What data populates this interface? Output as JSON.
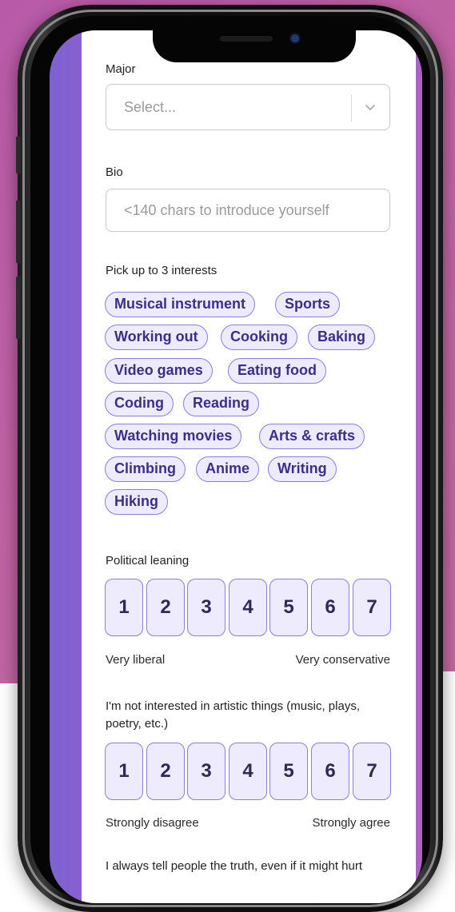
{
  "form": {
    "major": {
      "label": "Major",
      "placeholder": "Select..."
    },
    "bio": {
      "label": "Bio",
      "placeholder": "<140 chars to introduce yourself"
    },
    "interests": {
      "label": "Pick up to 3 interests",
      "chips": [
        "Musical instrument",
        "Sports",
        "Working out",
        "Cooking",
        "Baking",
        "Video games",
        "Eating food",
        "Coding",
        "Reading",
        "Watching movies",
        "Arts & crafts",
        "Climbing",
        "Anime",
        "Writing",
        "Hiking"
      ]
    },
    "political": {
      "label": "Political leaning",
      "options": [
        "1",
        "2",
        "3",
        "4",
        "5",
        "6",
        "7"
      ],
      "left_label": "Very liberal",
      "right_label": "Very conservative"
    },
    "artistic": {
      "label": "I'm not interested in artistic things (music, plays, poetry, etc.)",
      "options": [
        "1",
        "2",
        "3",
        "4",
        "5",
        "6",
        "7"
      ],
      "left_label": "Strongly disagree",
      "right_label": "Strongly agree"
    },
    "truth": {
      "label": "I always tell people the truth, even if it might hurt"
    }
  },
  "icons": {
    "select_chevron": "chevron-down-icon"
  },
  "colors": {
    "chip_border": "#8b7ce0",
    "chip_fill": "#eeeaff",
    "chip_text": "#3b2f86",
    "background": "#c063a4"
  }
}
